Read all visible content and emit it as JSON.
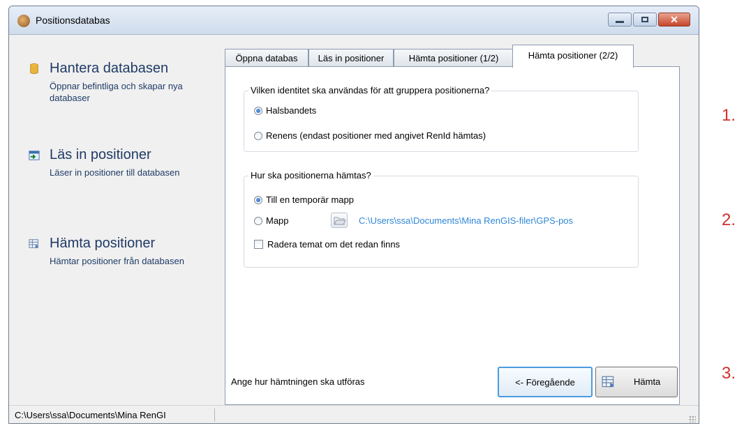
{
  "window": {
    "title": "Positionsdatabas"
  },
  "nav": {
    "items": [
      {
        "title": "Hantera databasen",
        "desc": "Öppnar befintliga och skapar nya databaser",
        "icon": "database-icon"
      },
      {
        "title": "Läs in positioner",
        "desc": "Läser in positioner till databasen",
        "icon": "import-icon"
      },
      {
        "title": "Hämta positioner",
        "desc": "Hämtar positioner från databasen",
        "icon": "fetch-icon"
      }
    ]
  },
  "tabs": [
    {
      "label": "Öppna databas"
    },
    {
      "label": "Läs in positioner"
    },
    {
      "label": "Hämta positioner (1/2)"
    },
    {
      "label": "Hämta positioner (2/2)"
    }
  ],
  "group1": {
    "legend": "Vilken identitet ska användas för att gruppera positionerna?",
    "options": [
      {
        "label": "Halsbandets",
        "checked": true
      },
      {
        "label": "Renens (endast positioner med angivet RenId hämtas)",
        "checked": false
      }
    ]
  },
  "group2": {
    "legend": "Hur ska positionerna hämtas?",
    "options": [
      {
        "label": "Till en temporär mapp",
        "checked": true
      },
      {
        "label": "Mapp",
        "checked": false
      }
    ],
    "folder_path": "C:\\Users\\ssa\\Documents\\Mina RenGIS-filer\\GPS-pos",
    "checkbox_label": "Radera temat om det redan finns"
  },
  "footer": {
    "message": "Ange hur hämtningen ska utföras",
    "prev_label": "<- Föregående",
    "fetch_label": "Hämta"
  },
  "statusbar": {
    "path": "C:\\Users\\ssa\\Documents\\Mina RenGI"
  },
  "annotations": [
    "1.",
    "2.",
    "3."
  ],
  "colors": {
    "link": "#2f87d8",
    "annotation": "#d0312d",
    "nav_text": "#1f3b66"
  }
}
